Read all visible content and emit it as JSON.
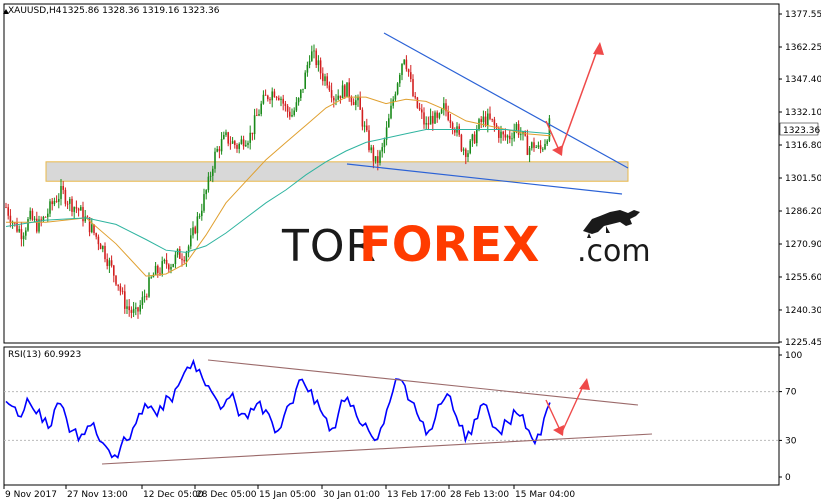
{
  "header": {
    "symbol": "XAUUSD,H4",
    "ohlc": "1325.86 1328.36 1319.16 1323.36",
    "rsi_label": "RSI(13) 60.9923"
  },
  "watermark": {
    "tor": "TOR",
    "forex": "FOREX",
    "com": ".com"
  },
  "colors": {
    "bull": "#1a8a1a",
    "bear": "#d21f1f",
    "ma_fast": "#e0a030",
    "ma_slow": "#2fb4a0",
    "trend_blue": "#2b62d6",
    "arrow_red": "#ef4a4a",
    "rsi_line": "#0000ff",
    "rsi_trend": "#9b6a6a",
    "zone_fill": "#d8d8d8",
    "zone_border": "#e8b84a"
  },
  "chart_data": [
    {
      "type": "candlestick",
      "title": "XAUUSD,H4",
      "ylim": [
        1225.45,
        1377.55
      ],
      "y_ticks": [
        "1377.55",
        "1362.25",
        "1347.40",
        "1332.10",
        "1316.80",
        "1301.50",
        "1286.20",
        "1270.90",
        "1255.60",
        "1240.30",
        "1225.45"
      ],
      "y_tick_values": [
        1377.55,
        1362.25,
        1347.4,
        1332.1,
        1316.8,
        1301.5,
        1286.2,
        1270.9,
        1255.6,
        1240.3,
        1225.45
      ],
      "last_price_label": "1323.36",
      "last_price": 1323.36,
      "x_labels": [
        "9 Nov 2017",
        "27 Nov 13:00",
        "12 Dec 05:00",
        "28 Dec 05:00",
        "15 Jan 05:00",
        "30 Jan 01:00",
        "13 Feb 17:00",
        "28 Feb 13:00",
        "15 Mar 04:00"
      ],
      "price_path": [
        [
          0,
          1288
        ],
        [
          8,
          1280
        ],
        [
          16,
          1276
        ],
        [
          24,
          1283
        ],
        [
          32,
          1279
        ],
        [
          40,
          1284
        ],
        [
          48,
          1291
        ],
        [
          56,
          1295
        ],
        [
          64,
          1290
        ],
        [
          72,
          1287
        ],
        [
          80,
          1282
        ],
        [
          88,
          1276
        ],
        [
          96,
          1270
        ],
        [
          104,
          1261
        ],
        [
          112,
          1253
        ],
        [
          118,
          1244
        ],
        [
          124,
          1240
        ],
        [
          130,
          1238
        ],
        [
          136,
          1244
        ],
        [
          142,
          1251
        ],
        [
          148,
          1257
        ],
        [
          154,
          1259
        ],
        [
          160,
          1262
        ],
        [
          166,
          1262
        ],
        [
          172,
          1266
        ],
        [
          178,
          1266
        ],
        [
          184,
          1271
        ],
        [
          190,
          1280
        ],
        [
          196,
          1289
        ],
        [
          202,
          1298
        ],
        [
          208,
          1311
        ],
        [
          214,
          1317
        ],
        [
          220,
          1320
        ],
        [
          226,
          1318
        ],
        [
          232,
          1316
        ],
        [
          238,
          1320
        ],
        [
          244,
          1321
        ],
        [
          250,
          1329
        ],
        [
          256,
          1336
        ],
        [
          262,
          1340
        ],
        [
          268,
          1342
        ],
        [
          274,
          1340
        ],
        [
          280,
          1333
        ],
        [
          286,
          1331
        ],
        [
          292,
          1336
        ],
        [
          298,
          1346
        ],
        [
          304,
          1360
        ],
        [
          310,
          1356
        ],
        [
          316,
          1349
        ],
        [
          322,
          1347
        ],
        [
          328,
          1339
        ],
        [
          334,
          1341
        ],
        [
          340,
          1343
        ],
        [
          346,
          1339
        ],
        [
          352,
          1336
        ],
        [
          358,
          1325
        ],
        [
          364,
          1315
        ],
        [
          370,
          1308
        ],
        [
          376,
          1314
        ],
        [
          382,
          1326
        ],
        [
          388,
          1340
        ],
        [
          394,
          1352
        ],
        [
          398,
          1359
        ],
        [
          402,
          1352
        ],
        [
          408,
          1337
        ],
        [
          414,
          1332
        ],
        [
          420,
          1325
        ],
        [
          426,
          1330
        ],
        [
          432,
          1327
        ],
        [
          438,
          1334
        ],
        [
          444,
          1330
        ],
        [
          450,
          1324
        ],
        [
          456,
          1316
        ],
        [
          462,
          1314
        ],
        [
          468,
          1320
        ],
        [
          474,
          1327
        ],
        [
          480,
          1329
        ],
        [
          486,
          1327
        ],
        [
          492,
          1323
        ],
        [
          498,
          1320
        ],
        [
          504,
          1321
        ],
        [
          510,
          1326
        ],
        [
          516,
          1321
        ],
        [
          522,
          1315
        ],
        [
          528,
          1317
        ],
        [
          534,
          1314
        ],
        [
          540,
          1320
        ],
        [
          544,
          1327
        ]
      ],
      "ma_fast_path": [
        [
          0,
          1281
        ],
        [
          40,
          1281
        ],
        [
          80,
          1283
        ],
        [
          110,
          1271
        ],
        [
          140,
          1256
        ],
        [
          160,
          1257
        ],
        [
          180,
          1262
        ],
        [
          200,
          1275
        ],
        [
          220,
          1290
        ],
        [
          240,
          1300
        ],
        [
          260,
          1310
        ],
        [
          280,
          1318
        ],
        [
          300,
          1326
        ],
        [
          320,
          1334
        ],
        [
          340,
          1339
        ],
        [
          360,
          1339
        ],
        [
          380,
          1336
        ],
        [
          400,
          1338
        ],
        [
          420,
          1337
        ],
        [
          440,
          1333
        ],
        [
          460,
          1328
        ],
        [
          480,
          1326
        ],
        [
          500,
          1324
        ],
        [
          520,
          1322
        ],
        [
          545,
          1321
        ]
      ],
      "ma_slow_path": [
        [
          0,
          1279
        ],
        [
          40,
          1282
        ],
        [
          80,
          1283
        ],
        [
          110,
          1280
        ],
        [
          140,
          1273
        ],
        [
          160,
          1268
        ],
        [
          180,
          1267
        ],
        [
          200,
          1270
        ],
        [
          220,
          1276
        ],
        [
          240,
          1283
        ],
        [
          260,
          1290
        ],
        [
          280,
          1296
        ],
        [
          300,
          1303
        ],
        [
          320,
          1309
        ],
        [
          340,
          1314
        ],
        [
          360,
          1318
        ],
        [
          380,
          1320
        ],
        [
          400,
          1322
        ],
        [
          420,
          1324
        ],
        [
          440,
          1324
        ],
        [
          460,
          1324
        ],
        [
          480,
          1324
        ],
        [
          500,
          1324
        ],
        [
          520,
          1323
        ],
        [
          545,
          1322
        ]
      ],
      "support_zone": [
        1300,
        1309
      ]
    },
    {
      "type": "line",
      "title": "RSI(13) 60.9923",
      "ylim": [
        0,
        100
      ],
      "y_ticks": [
        "100",
        "70",
        "30",
        "0"
      ],
      "y_tick_values": [
        100,
        70,
        30,
        0
      ],
      "series": [
        {
          "name": "RSI(13)",
          "values": [
            62,
            58,
            50,
            55,
            60,
            52,
            45,
            40,
            55,
            60,
            48,
            38,
            30,
            35,
            42,
            35,
            28,
            22,
            18,
            25,
            30,
            40,
            52,
            60,
            58,
            50,
            55,
            65,
            72,
            80,
            90,
            95,
            88,
            75,
            70,
            62,
            58,
            65,
            60,
            52,
            48,
            55,
            62,
            55,
            45,
            38,
            50,
            60,
            72,
            80,
            70,
            60,
            55,
            48,
            40,
            52,
            62,
            58,
            50,
            42,
            38,
            30,
            40,
            55,
            70,
            80,
            75,
            62,
            52,
            45,
            38,
            48,
            60,
            68,
            55,
            42,
            30,
            35,
            48,
            60,
            50,
            40,
            35,
            45,
            55,
            50,
            40,
            32,
            35,
            48,
            61
          ]
        }
      ]
    }
  ]
}
